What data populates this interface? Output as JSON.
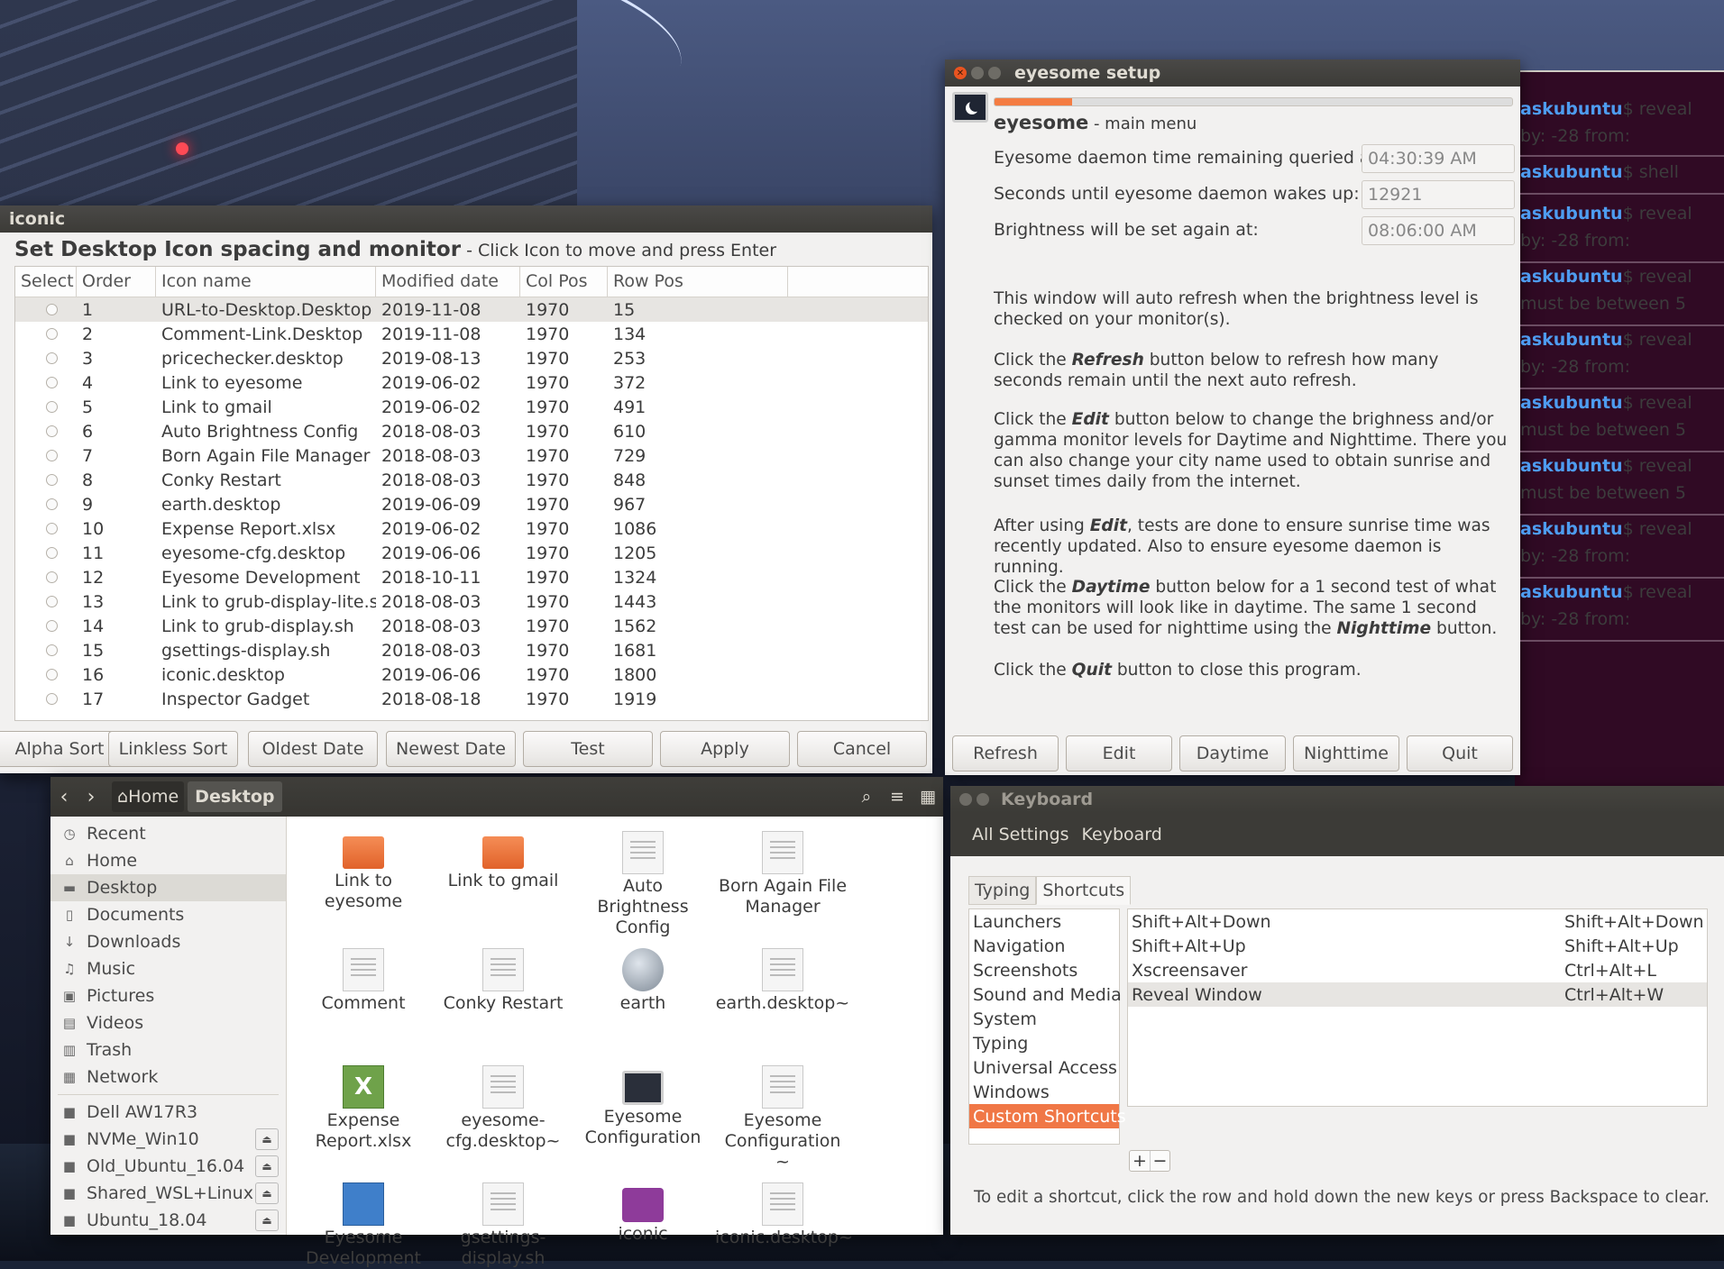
{
  "terminal": {
    "tab_close": "×",
    "lines": [
      {
        "prompt": "askubuntu",
        "text": "$ reveal"
      },
      {
        "prompt": "",
        "text": "by: -28 from:"
      },
      {
        "prompt": "askubuntu",
        "text": "$ shell"
      },
      {
        "prompt": "askubuntu",
        "text": "$ reveal"
      },
      {
        "prompt": "",
        "text": "by: -28 from:"
      },
      {
        "prompt": "askubuntu",
        "text": "$ reveal"
      },
      {
        "prompt": "",
        "text": "must be between 5"
      },
      {
        "prompt": "askubuntu",
        "text": "$ reveal"
      },
      {
        "prompt": "",
        "text": "by: -28 from:"
      },
      {
        "prompt": "askubuntu",
        "text": "$ reveal"
      },
      {
        "prompt": "",
        "text": "must be between 5"
      },
      {
        "prompt": "askubuntu",
        "text": "$ reveal"
      },
      {
        "prompt": "",
        "text": "must be between 5"
      },
      {
        "prompt": "askubuntu",
        "text": "$ reveal"
      },
      {
        "prompt": "",
        "text": "by: -28 from:"
      },
      {
        "prompt": "askubuntu",
        "text": "$ reveal"
      },
      {
        "prompt": "",
        "text": "by: -28 from:"
      }
    ]
  },
  "iconic": {
    "title": "iconic",
    "heading": "Set Desktop Icon spacing and monitor",
    "subheading": " - Click Icon to move and press Enter",
    "columns": [
      "Select",
      "Order",
      "Icon name",
      "Modified date",
      "Col Pos",
      "Row Pos"
    ],
    "rows": [
      [
        "1",
        "URL-to-Desktop.Desktop",
        "2019-11-08",
        "1970",
        "15"
      ],
      [
        "2",
        "Comment-Link.Desktop",
        "2019-11-08",
        "1970",
        "134"
      ],
      [
        "3",
        "pricechecker.desktop",
        "2019-08-13",
        "1970",
        "253"
      ],
      [
        "4",
        "Link to eyesome",
        "2019-06-02",
        "1970",
        "372"
      ],
      [
        "5",
        "Link to gmail",
        "2019-06-02",
        "1970",
        "491"
      ],
      [
        "6",
        "Auto Brightness Config",
        "2018-08-03",
        "1970",
        "610"
      ],
      [
        "7",
        "Born Again File Manager",
        "2018-08-03",
        "1970",
        "729"
      ],
      [
        "8",
        "Conky Restart",
        "2018-08-03",
        "1970",
        "848"
      ],
      [
        "9",
        "earth.desktop",
        "2019-06-09",
        "1970",
        "967"
      ],
      [
        "10",
        "Expense Report.xlsx",
        "2019-06-02",
        "1970",
        "1086"
      ],
      [
        "11",
        "eyesome-cfg.desktop",
        "2019-06-06",
        "1970",
        "1205"
      ],
      [
        "12",
        "Eyesome Development",
        "2018-10-11",
        "1970",
        "1324"
      ],
      [
        "13",
        "Link to grub-display-lite.sh",
        "2018-08-03",
        "1970",
        "1443"
      ],
      [
        "14",
        "Link to grub-display.sh",
        "2018-08-03",
        "1970",
        "1562"
      ],
      [
        "15",
        "gsettings-display.sh",
        "2018-08-03",
        "1970",
        "1681"
      ],
      [
        "16",
        "iconic.desktop",
        "2019-06-06",
        "1970",
        "1800"
      ],
      [
        "17",
        "Inspector Gadget",
        "2018-08-18",
        "1970",
        "1919"
      ]
    ],
    "buttons": [
      "Alpha Sort",
      "Linkless Sort",
      "Oldest Date",
      "Newest Date",
      "Test",
      "Apply",
      "Cancel"
    ]
  },
  "eyesome": {
    "title": "eyesome setup",
    "progress": 0.15,
    "app_name": "eyesome",
    "menu_label": " - main menu",
    "fields": [
      {
        "label": "Eyesome daemon time remaining queried at:",
        "value": "04:30:39 AM"
      },
      {
        "label": "Seconds until eyesome daemon wakes up:",
        "value": "12921"
      },
      {
        "label": "Brightness will be set again at:",
        "value": "08:06:00 AM"
      }
    ],
    "paragraphs": [
      {
        "before": "This window will auto refresh when the brightness level is checked on your monitor(s).",
        "em": "",
        "after": "",
        "em2": "",
        "after2": ""
      },
      {
        "before": "Click the ",
        "em": "Refresh",
        "after": " button below to refresh how many seconds remain until the next auto refresh.",
        "em2": "",
        "after2": ""
      },
      {
        "before": "Click the ",
        "em": "Edit",
        "after": " button below to change the brighness and/or gamma monitor levels for Daytime and Nighttime. There you can also change your city name used to obtain sunrise and sunset times daily from the internet.",
        "em2": "",
        "after2": ""
      },
      {
        "before": "After using ",
        "em": "Edit",
        "after": ", tests are done to ensure sunrise time was recently updated. Also to ensure eyesome daemon is running.",
        "em2": "",
        "after2": ""
      },
      {
        "before": "Click the ",
        "em": "Daytime",
        "after": " button below for a 1 second test of what the monitors will look like in daytime. The same 1 second test can be used for nighttime using the ",
        "em2": "Nighttime",
        "after2": " button."
      },
      {
        "before": "Click the ",
        "em": "Quit",
        "after": " button to close this program.",
        "em2": "",
        "after2": ""
      }
    ],
    "buttons": [
      "Refresh",
      "Edit",
      "Daytime",
      "Nighttime",
      "Quit"
    ]
  },
  "files": {
    "crumb_home": "Home",
    "crumb_current": "Desktop",
    "sidebar": [
      {
        "icon": "clock-icon",
        "glyph": "◷",
        "label": "Recent"
      },
      {
        "icon": "home-icon",
        "glyph": "⌂",
        "label": "Home"
      },
      {
        "icon": "folder-icon",
        "glyph": "▬",
        "label": "Desktop"
      },
      {
        "icon": "document-icon",
        "glyph": "▯",
        "label": "Documents"
      },
      {
        "icon": "download-icon",
        "glyph": "↓",
        "label": "Downloads"
      },
      {
        "icon": "music-icon",
        "glyph": "♫",
        "label": "Music"
      },
      {
        "icon": "camera-icon",
        "glyph": "▣",
        "label": "Pictures"
      },
      {
        "icon": "video-icon",
        "glyph": "▤",
        "label": "Videos"
      },
      {
        "icon": "trash-icon",
        "glyph": "▥",
        "label": "Trash"
      },
      {
        "icon": "network-icon",
        "glyph": "▦",
        "label": "Network"
      }
    ],
    "devices": [
      {
        "label": "Dell AW17R3",
        "eject": false
      },
      {
        "label": "NVMe_Win10",
        "eject": true
      },
      {
        "label": "Old_Ubuntu_16.04",
        "eject": true
      },
      {
        "label": "Shared_WSL+Linux",
        "eject": true
      },
      {
        "label": "Ubuntu_18.04",
        "eject": true
      }
    ],
    "items": [
      {
        "label": "Link to eyesome",
        "type": "folder"
      },
      {
        "label": "Link to gmail",
        "type": "folder"
      },
      {
        "label": "Auto Brightness Config",
        "type": "doc"
      },
      {
        "label": "Born Again File Manager",
        "type": "doc"
      },
      {
        "label": "Comment",
        "type": "doc"
      },
      {
        "label": "Conky Restart",
        "type": "doc"
      },
      {
        "label": "earth",
        "type": "globe"
      },
      {
        "label": "earth.desktop~",
        "type": "doc"
      },
      {
        "label": "Expense Report.xlsx",
        "type": "sheet"
      },
      {
        "label": "eyesome-cfg.desktop~",
        "type": "doc"
      },
      {
        "label": "Eyesome Configuration",
        "type": "monitor"
      },
      {
        "label": "Eyesome Configuration ~",
        "type": "doc"
      },
      {
        "label": "Eyesome Development",
        "type": "writer"
      },
      {
        "label": "gsettings-display.sh",
        "type": "doc"
      },
      {
        "label": "iconic",
        "type": "purple"
      },
      {
        "label": "iconic.desktop~",
        "type": "doc"
      }
    ]
  },
  "keyboard": {
    "title": "Keyboard",
    "nav": [
      "All Settings",
      "Keyboard"
    ],
    "tabs": [
      "Typing",
      "Shortcuts"
    ],
    "categories": [
      "Launchers",
      "Navigation",
      "Screenshots",
      "Sound and Media",
      "System",
      "Typing",
      "Universal Access",
      "Windows",
      "Custom Shortcuts"
    ],
    "shortcuts": [
      {
        "action": "Shift+Alt+Down",
        "keys": "Shift+Alt+Down"
      },
      {
        "action": "Shift+Alt+Up",
        "keys": "Shift+Alt+Up"
      },
      {
        "action": "Xscreensaver",
        "keys": "Ctrl+Alt+L"
      },
      {
        "action": "Reveal Window",
        "keys": "Ctrl+Alt+W"
      }
    ],
    "add": "+",
    "remove": "−",
    "hint": "To edit a shortcut, click the row and hold down the new keys or press Backspace to clear."
  }
}
